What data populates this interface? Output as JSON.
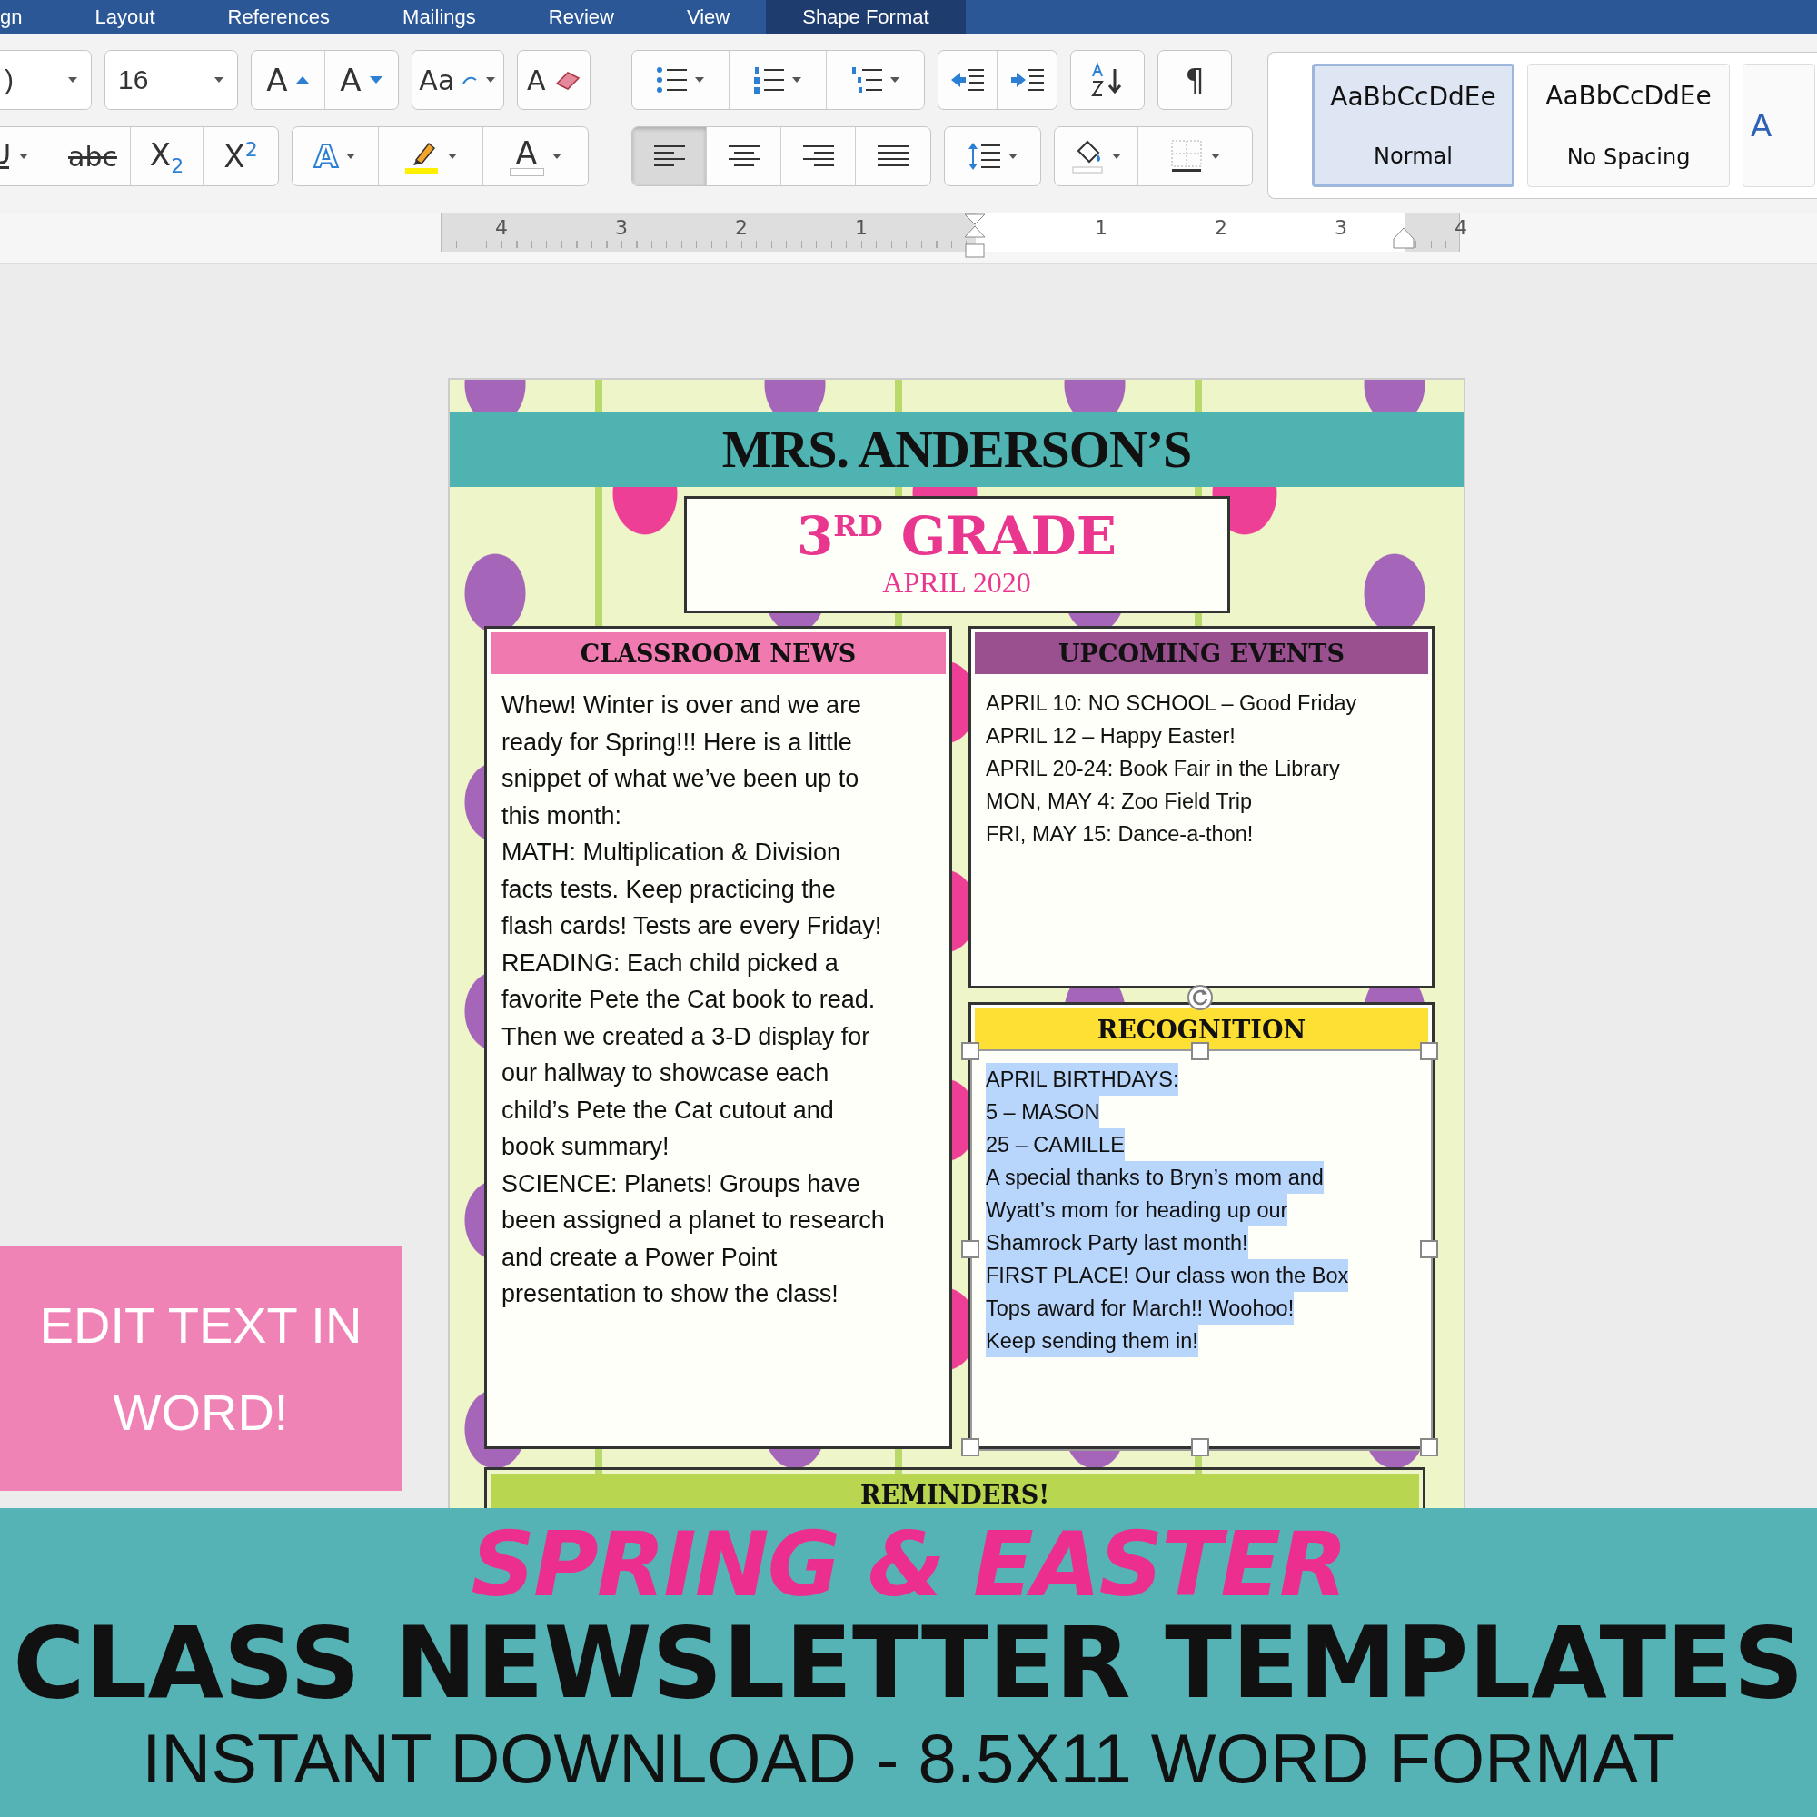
{
  "ribbon": {
    "tabs": [
      {
        "label": "gn",
        "selected": false
      },
      {
        "label": "Layout",
        "selected": false
      },
      {
        "label": "References",
        "selected": false
      },
      {
        "label": "Mailings",
        "selected": false
      },
      {
        "label": "Review",
        "selected": false
      },
      {
        "label": "View",
        "selected": false
      },
      {
        "label": "Shape Format",
        "selected": true
      }
    ]
  },
  "toolbar": {
    "font_rows": [
      [
        [
          {
            "kind": "fontname",
            "value": ")"
          }
        ],
        [
          {
            "kind": "fontsize",
            "value": "16"
          }
        ],
        [
          {
            "kind": "grow",
            "label": "A"
          },
          {
            "kind": "shrink",
            "label": "A"
          }
        ],
        [
          {
            "kind": "case",
            "label": "Aa"
          }
        ],
        [
          {
            "kind": "clear",
            "label": "A"
          }
        ]
      ],
      [
        [
          {
            "kind": "underline"
          },
          {
            "kind": "strike",
            "label": "abc"
          },
          {
            "kind": "sub",
            "label": "X$_{2}$"
          },
          {
            "kind": "sup",
            "label": "X$^{2}$"
          }
        ],
        [
          {
            "kind": "effects",
            "label": "A"
          },
          {
            "kind": "highlight"
          },
          {
            "kind": "fontcolor",
            "label": "A"
          }
        ]
      ]
    ],
    "paragraph_rows": [
      [
        [
          {
            "kind": "bullets"
          },
          {
            "kind": "numbering"
          },
          {
            "kind": "multilevel"
          }
        ],
        [
          {
            "kind": "outdent"
          },
          {
            "kind": "indent"
          }
        ],
        [
          {
            "kind": "sort"
          }
        ],
        [
          {
            "kind": "pilcrow",
            "label": "¶"
          }
        ]
      ],
      [
        [
          {
            "kind": "alignleft",
            "selected": true
          },
          {
            "kind": "aligncenter",
            "selected": false
          },
          {
            "kind": "alignright",
            "selected": false
          },
          {
            "kind": "justify",
            "selected": false
          }
        ],
        [
          {
            "kind": "spacing"
          }
        ],
        [
          {
            "kind": "shading"
          },
          {
            "kind": "borders"
          }
        ]
      ]
    ],
    "styles": [
      {
        "kind": "body",
        "preview": "AaBbCcDdEe",
        "name": "Normal",
        "selected": true
      },
      {
        "kind": "body",
        "preview": "AaBbCcDdEe",
        "name": "No Spacing",
        "selected": false
      },
      {
        "kind": "heading",
        "preview": "A",
        "selected": false
      }
    ]
  },
  "ruler": {
    "labels": [
      "4",
      "3",
      "2",
      "1",
      "1",
      "2",
      "3",
      "4"
    ]
  },
  "document": {
    "title": "MRS. ANDERSON’S",
    "grade": "3$^{RD}$ GRADE",
    "date": "APRIL 2020",
    "sections": [
      {
        "kind": "news",
        "heading": "CLASSROOM NEWS",
        "color": "#f07ab0",
        "selected": false,
        "lines": [
          "Whew!  Winter is over and we are",
          "ready for Spring!!!  Here is a little",
          "snippet of what we’ve been up to",
          "this month:",
          "MATH: Multiplication & Division",
          "facts tests.  Keep practicing the",
          "flash cards!  Tests are every Friday!",
          "READING: Each child picked a",
          "favorite Pete the Cat book to read.",
          "Then we created a 3-D display for",
          "our hallway to showcase each",
          "child’s Pete the Cat cutout and",
          "book summary!",
          "SCIENCE: Planets!  Groups have",
          "been assigned a planet to research",
          "and create a Power Point",
          "presentation to show the class!"
        ]
      },
      {
        "kind": "events",
        "heading": "UPCOMING EVENTS",
        "color": "#9a4f8f",
        "selected": false,
        "lines": [
          "APRIL 10: NO SCHOOL – Good Friday",
          "APRIL 12 – Happy Easter!",
          "APRIL 20-24: Book Fair in the Library",
          "MON, MAY 4: Zoo Field Trip",
          "FRI, MAY 15: Dance-a-thon!"
        ]
      },
      {
        "kind": "recognition",
        "heading": "RECOGNITION",
        "color": "#fde033",
        "selected": true,
        "lines": [
          "APRIL BIRTHDAYS:",
          "5 – MASON",
          "25 – CAMILLE",
          "A special thanks to Bryn’s mom and",
          "Wyatt’s mom for heading up our",
          "Shamrock Party last month!",
          "FIRST PLACE! Our class won the Box",
          "Tops award for March!!  Woohoo!",
          "Keep sending them in!"
        ]
      },
      {
        "kind": "reminders",
        "heading": "REMINDERS!",
        "color": "#b8d650",
        "selected": false
      }
    ]
  },
  "badge": {
    "text": "EDIT TEXT IN WORD!"
  },
  "promo": {
    "line1": "SPRING & EASTER",
    "line2": "CLASS NEWSLETTER TEMPLATES",
    "line3": "INSTANT DOWNLOAD - 8.5X11 WORD FORMAT"
  }
}
